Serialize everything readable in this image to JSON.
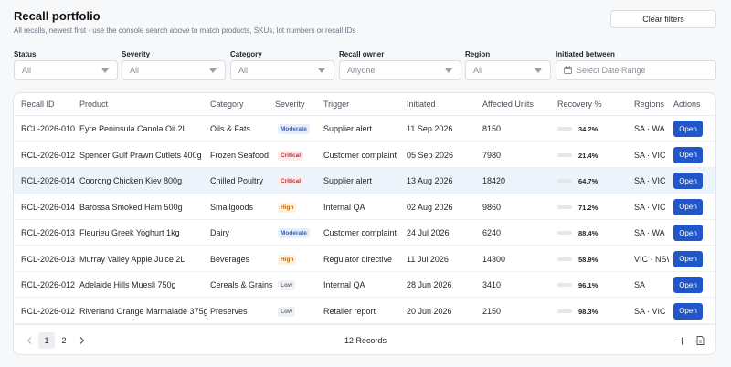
{
  "header": {
    "title": "Recall portfolio",
    "subtitle": "All recalls, newest first · use the console search above to match products, SKUs, lot numbers or recall IDs",
    "clear_filters": "Clear filters"
  },
  "filters": {
    "status": {
      "label": "Status",
      "value": "All"
    },
    "severity": {
      "label": "Severity",
      "value": "All"
    },
    "category": {
      "label": "Category",
      "value": "All"
    },
    "owner": {
      "label": "Recall owner",
      "value": "Anyone"
    },
    "region": {
      "label": "Region",
      "value": "All"
    },
    "dates": {
      "label": "Initiated between",
      "placeholder": "Select Date Range"
    }
  },
  "table": {
    "columns": [
      "Recall ID",
      "Product",
      "Category",
      "Severity",
      "Trigger",
      "Initiated",
      "Affected Units",
      "Recovery %",
      "Regions",
      "Actions"
    ],
    "rows": [
      {
        "id": "RCL-2026-010",
        "product": "Eyre Peninsula Canola Oil 2L",
        "category": "Oils & Fats",
        "severity": "Moderate",
        "sev": "moderate",
        "trigger": "Supplier alert",
        "initiated": "11 Sep 2026",
        "units": "8150",
        "recovery": 34.2,
        "recovery_label": "34.2%",
        "recovery_color": "#c6303a",
        "regions": "SA · WA",
        "action": "Open"
      },
      {
        "id": "RCL-2026-012",
        "product": "Spencer Gulf Prawn Cutlets 400g",
        "category": "Frozen Seafood",
        "severity": "Critical",
        "sev": "critical",
        "trigger": "Customer complaint",
        "initiated": "05 Sep 2026",
        "units": "7980",
        "recovery": 21.4,
        "recovery_label": "21.4%",
        "recovery_color": "#c6303a",
        "regions": "SA · VIC ·",
        "action": "Open"
      },
      {
        "id": "RCL-2026-014",
        "product": "Coorong Chicken Kiev 800g",
        "category": "Chilled Poultry",
        "severity": "Critical",
        "sev": "critical",
        "trigger": "Supplier alert",
        "initiated": "13 Aug 2026",
        "units": "18420",
        "recovery": 64.7,
        "recovery_label": "64.7%",
        "recovery_color": "#e08a1e",
        "regions": "SA · VIC ·",
        "action": "Open"
      },
      {
        "id": "RCL-2026-014",
        "product": "Barossa Smoked Ham 500g",
        "category": "Smallgoods",
        "severity": "High",
        "sev": "high",
        "trigger": "Internal QA",
        "initiated": "02 Aug 2026",
        "units": "9860",
        "recovery": 71.2,
        "recovery_label": "71.2%",
        "recovery_color": "#e08a1e",
        "regions": "SA · VIC",
        "action": "Open"
      },
      {
        "id": "RCL-2026-013",
        "product": "Fleurieu Greek Yoghurt 1kg",
        "category": "Dairy",
        "severity": "Moderate",
        "sev": "moderate",
        "trigger": "Customer complaint",
        "initiated": "24 Jul 2026",
        "units": "6240",
        "recovery": 88.4,
        "recovery_label": "88.4%",
        "recovery_color": "#2ea44f",
        "regions": "SA · WA",
        "action": "Open"
      },
      {
        "id": "RCL-2026-013",
        "product": "Murray Valley Apple Juice 2L",
        "category": "Beverages",
        "severity": "High",
        "sev": "high",
        "trigger": "Regulator directive",
        "initiated": "11 Jul 2026",
        "units": "14300",
        "recovery": 58.9,
        "recovery_label": "58.9%",
        "recovery_color": "#e08a1e",
        "regions": "VIC · NSW",
        "action": "Open"
      },
      {
        "id": "RCL-2026-012",
        "product": "Adelaide Hills Muesli 750g",
        "category": "Cereals & Grains",
        "severity": "Low",
        "sev": "low",
        "trigger": "Internal QA",
        "initiated": "28 Jun 2026",
        "units": "3410",
        "recovery": 96.1,
        "recovery_label": "96.1%",
        "recovery_color": "#2ea44f",
        "regions": "SA",
        "action": "Open"
      },
      {
        "id": "RCL-2026-012",
        "product": "Riverland Orange Marmalade 375g",
        "category": "Preserves",
        "severity": "Low",
        "sev": "low",
        "trigger": "Retailer report",
        "initiated": "20 Jun 2026",
        "units": "2150",
        "recovery": 98.3,
        "recovery_label": "98.3%",
        "recovery_color": "#2ea44f",
        "regions": "SA · VIC",
        "action": "Open"
      }
    ],
    "highlighted_row": 2
  },
  "footer": {
    "pages": [
      "1",
      "2"
    ],
    "current_page": "1",
    "records": "12 Records"
  }
}
